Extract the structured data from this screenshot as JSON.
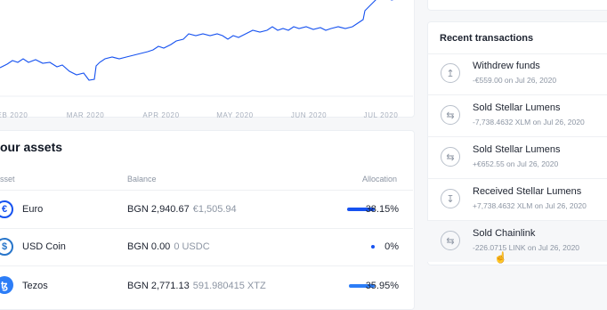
{
  "chart": {
    "x_ticks": [
      "EB 2020",
      "MAR 2020",
      "APR 2020",
      "MAY 2020",
      "JUN 2020",
      "JUL 2020"
    ],
    "line_color": "#1652f0"
  },
  "assets": {
    "title": "our assets",
    "headers": {
      "asset": "sset",
      "balance": "Balance",
      "allocation": "Allocation"
    },
    "rows": [
      {
        "name": "Euro",
        "balance": "BGN 2,940.67",
        "sub_balance": "€1,505.94",
        "allocation": "38.15%",
        "allocation_value": 0.3815,
        "icon": "euro-icon",
        "icon_glyph": "€",
        "icon_color": "#1652f0"
      },
      {
        "name": "USD Coin",
        "balance": "BGN 0.00",
        "sub_balance": "0 USDC",
        "allocation": "0%",
        "allocation_value": 0.0,
        "icon": "usd-coin-icon",
        "icon_glyph": "$",
        "icon_color": "#2775ca"
      },
      {
        "name": "Tezos",
        "balance": "BGN 2,771.13",
        "sub_balance": "591.980415 XTZ",
        "allocation": "35.95%",
        "allocation_value": 0.3595,
        "icon": "tezos-icon",
        "icon_glyph": "ꜩ",
        "icon_color": "#2c7df7"
      }
    ]
  },
  "transactions": {
    "title": "Recent transactions",
    "items": [
      {
        "title": "Withdrew funds",
        "detail": "-€559.00 on Jul 26, 2020",
        "icon": "upload-arrow-icon",
        "glyph": "↥"
      },
      {
        "title": "Sold Stellar Lumens",
        "detail": "-7,738.4632 XLM on Jul 26, 2020",
        "icon": "swap-arrows-icon",
        "glyph": "⇆"
      },
      {
        "title": "Sold Stellar Lumens",
        "detail": "+€652.55 on Jul 26, 2020",
        "icon": "swap-arrows-icon",
        "glyph": "⇆"
      },
      {
        "title": "Received Stellar Lumens",
        "detail": "+7,738.4632 XLM on Jul 26, 2020",
        "icon": "download-arrow-icon",
        "glyph": "↧"
      },
      {
        "title": "Sold Chainlink",
        "detail": "-226.0715 LINK on Jul 26, 2020",
        "icon": "swap-arrows-icon",
        "glyph": "⇆"
      }
    ]
  }
}
